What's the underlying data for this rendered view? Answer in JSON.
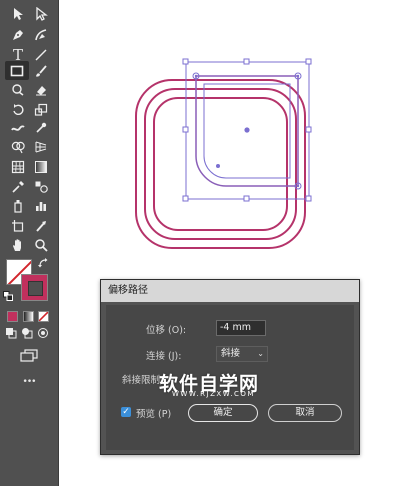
{
  "toolbar": {
    "tools": [
      {
        "name": "selection-tool-icon"
      },
      {
        "name": "direct-selection-tool-icon"
      },
      {
        "name": "pen-tool-icon"
      },
      {
        "name": "curvature-tool-icon"
      },
      {
        "name": "type-tool-icon",
        "glyph": "T"
      },
      {
        "name": "line-segment-tool-icon"
      },
      {
        "name": "rectangle-tool-icon",
        "selected": true
      },
      {
        "name": "paintbrush-tool-icon"
      },
      {
        "name": "shaper-tool-icon"
      },
      {
        "name": "eraser-tool-icon"
      },
      {
        "name": "rotate-tool-icon"
      },
      {
        "name": "scale-tool-icon"
      },
      {
        "name": "warp-tool-icon"
      },
      {
        "name": "puppet-warp-tool-icon"
      },
      {
        "name": "shape-builder-tool-icon"
      },
      {
        "name": "perspective-grid-tool-icon"
      },
      {
        "name": "mesh-tool-icon"
      },
      {
        "name": "gradient-tool-icon"
      },
      {
        "name": "eyedropper-tool-icon"
      },
      {
        "name": "blend-tool-icon"
      },
      {
        "name": "symbol-sprayer-tool-icon"
      },
      {
        "name": "column-graph-tool-icon"
      },
      {
        "name": "artboard-tool-icon"
      },
      {
        "name": "slice-tool-icon"
      },
      {
        "name": "hand-tool-icon"
      },
      {
        "name": "zoom-tool-icon"
      }
    ],
    "fill_color": "#ffffff",
    "stroke_color": "#c0305d",
    "more_glyph": "•••"
  },
  "artwork": {
    "stroke_color": "#b5336a",
    "selection_color": "#7b6fd0"
  },
  "dialog": {
    "title": "偏移路径",
    "offset_label": "位移 (O):",
    "offset_value": "-4 mm",
    "joins_label": "连接 (J):",
    "joins_value": "斜接",
    "miter_limit_label": "斜接限制",
    "preview_label": "预览 (P)",
    "preview_checked": true,
    "ok_label": "确定",
    "cancel_label": "取消"
  },
  "watermark": {
    "main": "软件自学网",
    "sub": "WWW.RJZXW.COM"
  }
}
